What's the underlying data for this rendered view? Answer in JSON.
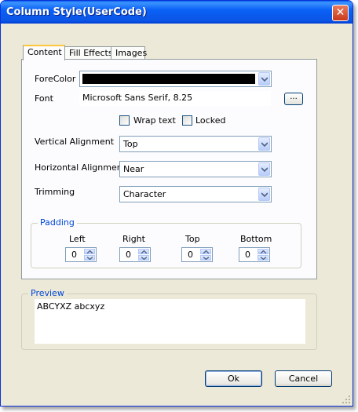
{
  "window": {
    "title": "Column Style(UserCode)"
  },
  "tabs": [
    {
      "label": "Content",
      "active": true
    },
    {
      "label": "Fill Effects",
      "active": false
    },
    {
      "label": "Images",
      "active": false
    }
  ],
  "content": {
    "forecolor_label": "ForeColor",
    "forecolor_value": "#000000",
    "font_label": "Font",
    "font_value": "Microsoft Sans Serif, 8.25",
    "font_button": "...",
    "wrap_text_label": "Wrap text",
    "wrap_text_checked": false,
    "locked_label": "Locked",
    "locked_checked": false,
    "vertical_alignment_label": "Vertical Alignment",
    "vertical_alignment_value": "Top",
    "horizontal_alignment_label": "Horizontal Alignment",
    "horizontal_alignment_value": "Near",
    "trimming_label": "Trimming",
    "trimming_value": "Character"
  },
  "padding": {
    "title": "Padding",
    "left_label": "Left",
    "left_value": "0",
    "right_label": "Right",
    "right_value": "0",
    "top_label": "Top",
    "top_value": "0",
    "bottom_label": "Bottom",
    "bottom_value": "0"
  },
  "preview": {
    "title": "Preview",
    "text": "ABCYXZ abcxyz"
  },
  "buttons": {
    "ok": "Ok",
    "cancel": "Cancel"
  },
  "icons": {
    "close": "close-icon",
    "dropdown": "chevron-down-icon",
    "spin_up": "chevron-up-icon",
    "spin_down": "chevron-down-icon",
    "grip": "resize-grip-icon"
  },
  "colors": {
    "titlebar": "#0b55e5",
    "dialog_bg": "#ece9d8",
    "group_title": "#0046d5",
    "tab_highlight": "#ffc73c"
  }
}
